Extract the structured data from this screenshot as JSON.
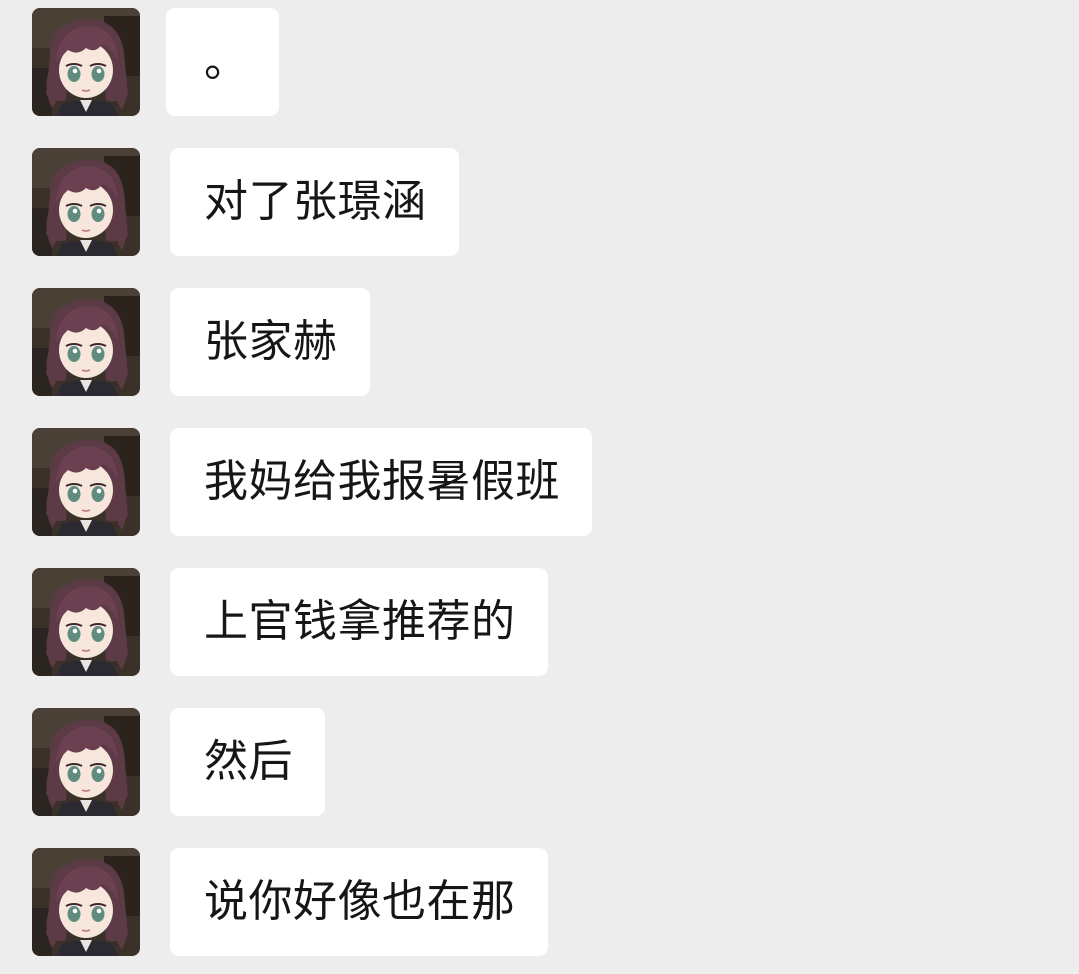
{
  "messages": [
    {
      "text": "。"
    },
    {
      "text": "对了张璟涵"
    },
    {
      "text": "张家赫"
    },
    {
      "text": "我妈给我报暑假班"
    },
    {
      "text": "上官钱拿推荐的"
    },
    {
      "text": "然后"
    },
    {
      "text": "说你好像也在那"
    }
  ],
  "colors": {
    "background": "#ededed",
    "bubble": "#ffffff",
    "text": "#161616"
  },
  "icons": {
    "avatar": "anime-girl-avatar-icon"
  }
}
